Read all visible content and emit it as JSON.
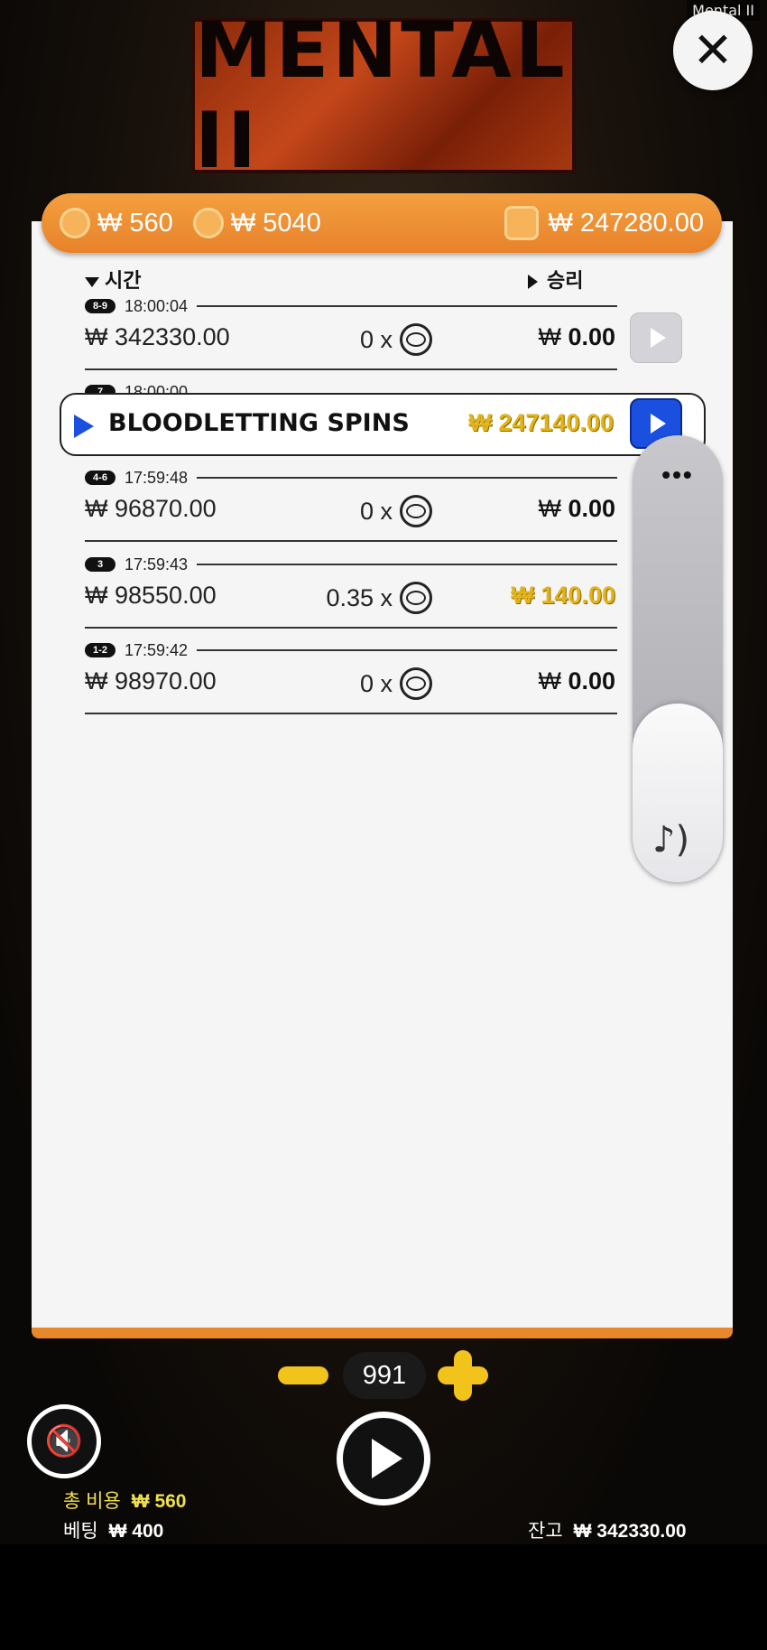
{
  "app": {
    "corner_title": "Mental II",
    "logo_text": "MENTAL II"
  },
  "summary": {
    "coin_bet": "₩ 560",
    "coin_total": "₩ 5040",
    "wallet": "₩ 247280.00"
  },
  "headers": {
    "time": "시간",
    "win": "승리"
  },
  "rows": [
    {
      "badge": "8-9",
      "time": "18:00:04",
      "bet": "₩ 342330.00",
      "mult": "0 x",
      "currency": "₩",
      "win": "0.00",
      "highlight": false
    },
    {
      "badge": "7",
      "time": "18:00:00",
      "feature": "BLOODLETTING SPINS",
      "win_full": "₩ 247140.00"
    },
    {
      "badge": "4-6",
      "time": "17:59:48",
      "bet": "₩ 96870.00",
      "mult": "0 x",
      "currency": "₩",
      "win": "0.00",
      "highlight": false
    },
    {
      "badge": "3",
      "time": "17:59:43",
      "bet": "₩ 98550.00",
      "mult": "0.35 x",
      "win_full": "₩ 140.00",
      "highlight": true
    },
    {
      "badge": "1-2",
      "time": "17:59:42",
      "bet": "₩ 98970.00",
      "mult": "0 x",
      "currency": "₩",
      "win": "0.00",
      "highlight": false
    }
  ],
  "side_panel": {
    "menu": "•••",
    "icon": "music-note-icon"
  },
  "stepper": {
    "value": "991"
  },
  "footer": {
    "total_cost_label": "총 비용",
    "total_cost_value": "₩ 560",
    "bet_label": "베팅",
    "bet_value": "₩ 400",
    "balance_label": "잔고",
    "balance_value": "₩ 342330.00"
  },
  "colors": {
    "accent_orange": "#e8822a",
    "gold": "#e2b31a",
    "blue": "#1a4fe0"
  }
}
